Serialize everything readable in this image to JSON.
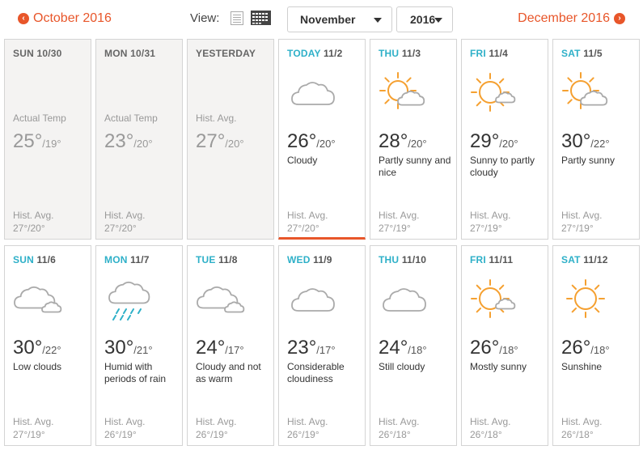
{
  "nav": {
    "prev_label": "October 2016",
    "next_label": "December 2016",
    "prev_icon": "left-arrow-icon",
    "next_icon": "right-arrow-icon",
    "accent_color": "#e8562a"
  },
  "view": {
    "label": "View:",
    "list_icon": "list-view-icon",
    "calendar_icon": "calendar-view-icon",
    "selected": "calendar"
  },
  "month_select": {
    "value": "November"
  },
  "year_select": {
    "value": "2016"
  },
  "days": [
    {
      "kind": "past",
      "day": "SUN",
      "date": "10/30",
      "label": "Actual Temp",
      "hi": "25°",
      "lo": "/19°",
      "cond": "",
      "hist_label": "Hist. Avg.",
      "hist": "27°/20°",
      "icon": ""
    },
    {
      "kind": "past",
      "day": "MON",
      "date": "10/31",
      "label": "Actual Temp",
      "hi": "23°",
      "lo": "/20°",
      "cond": "",
      "hist_label": "Hist. Avg.",
      "hist": "27°/20°",
      "icon": ""
    },
    {
      "kind": "past",
      "day": "YESTERDAY",
      "date": "",
      "label": "Hist. Avg.",
      "hi": "27°",
      "lo": "/20°",
      "cond": "",
      "hist_label": "",
      "hist": "",
      "icon": ""
    },
    {
      "kind": "today",
      "day": "TODAY",
      "date": "11/2",
      "label": "",
      "hi": "26°",
      "lo": "/20°",
      "cond": "Cloudy",
      "hist_label": "Hist. Avg.",
      "hist": "27°/20°",
      "icon": "cloud-icon"
    },
    {
      "kind": "future",
      "day": "THU",
      "date": "11/3",
      "label": "",
      "hi": "28°",
      "lo": "/20°",
      "cond": "Partly sunny and nice",
      "hist_label": "Hist. Avg.",
      "hist": "27°/19°",
      "icon": "sun-cloud-icon"
    },
    {
      "kind": "future",
      "day": "FRI",
      "date": "11/4",
      "label": "",
      "hi": "29°",
      "lo": "/20°",
      "cond": "Sunny to partly cloudy",
      "hist_label": "Hist. Avg.",
      "hist": "27°/19°",
      "icon": "sun-small-cloud-icon"
    },
    {
      "kind": "future",
      "day": "SAT",
      "date": "11/5",
      "label": "",
      "hi": "30°",
      "lo": "/22°",
      "cond": "Partly sunny",
      "hist_label": "Hist. Avg.",
      "hist": "27°/19°",
      "icon": "sun-cloud-icon"
    },
    {
      "kind": "future",
      "day": "SUN",
      "date": "11/6",
      "label": "",
      "hi": "30°",
      "lo": "/22°",
      "cond": "Low clouds",
      "hist_label": "Hist. Avg.",
      "hist": "27°/19°",
      "icon": "clouds-icon"
    },
    {
      "kind": "future",
      "day": "MON",
      "date": "11/7",
      "label": "",
      "hi": "30°",
      "lo": "/21°",
      "cond": "Humid with periods of rain",
      "hist_label": "Hist. Avg.",
      "hist": "26°/19°",
      "icon": "rain-cloud-icon"
    },
    {
      "kind": "future",
      "day": "TUE",
      "date": "11/8",
      "label": "",
      "hi": "24°",
      "lo": "/17°",
      "cond": "Cloudy and not as warm",
      "hist_label": "Hist. Avg.",
      "hist": "26°/19°",
      "icon": "clouds-icon"
    },
    {
      "kind": "future",
      "day": "WED",
      "date": "11/9",
      "label": "",
      "hi": "23°",
      "lo": "/17°",
      "cond": "Considerable cloudiness",
      "hist_label": "Hist. Avg.",
      "hist": "26°/19°",
      "icon": "cloud-icon"
    },
    {
      "kind": "future",
      "day": "THU",
      "date": "11/10",
      "label": "",
      "hi": "24°",
      "lo": "/18°",
      "cond": "Still cloudy",
      "hist_label": "Hist. Avg.",
      "hist": "26°/18°",
      "icon": "cloud-icon"
    },
    {
      "kind": "future",
      "day": "FRI",
      "date": "11/11",
      "label": "",
      "hi": "26°",
      "lo": "/18°",
      "cond": "Mostly sunny",
      "hist_label": "Hist. Avg.",
      "hist": "26°/18°",
      "icon": "sun-small-cloud-icon"
    },
    {
      "kind": "future",
      "day": "SAT",
      "date": "11/12",
      "label": "",
      "hi": "26°",
      "lo": "/18°",
      "cond": "Sunshine",
      "hist_label": "Hist. Avg.",
      "hist": "26°/18°",
      "icon": "sun-icon"
    }
  ],
  "colors": {
    "day_highlight": "#2eb0c8",
    "sun": "#f5a030",
    "cloud": "#aaaaaa",
    "rain": "#2eb0c8"
  }
}
